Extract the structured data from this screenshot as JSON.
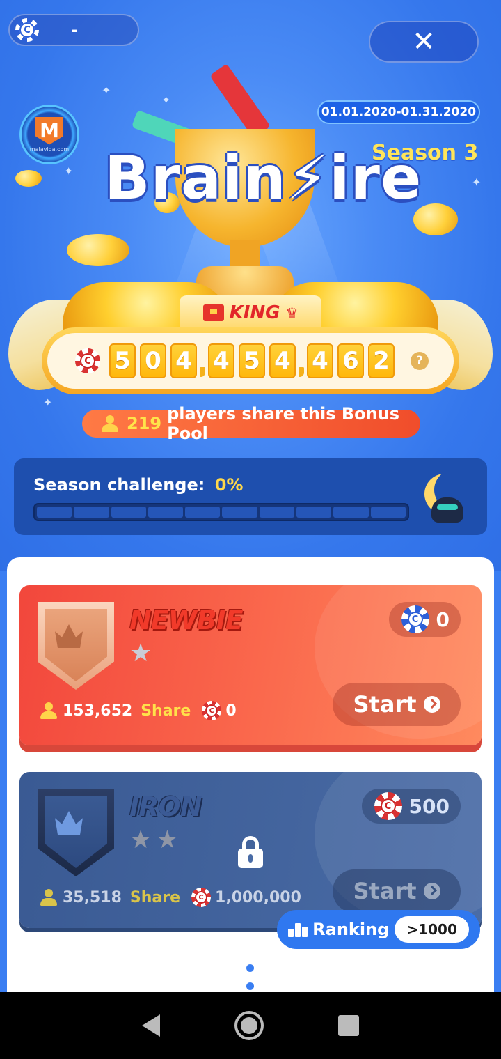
{
  "header": {
    "coin_balance": "-",
    "close_symbol": "✕",
    "date_range": "01.01.2020-01.31.2020",
    "season": "Season 3",
    "brand": "Brain⚡ire"
  },
  "prize_pool": {
    "tag": "KING",
    "digits": [
      "5",
      "0",
      "4",
      "4",
      "5",
      "4",
      "4",
      "6",
      "2"
    ],
    "help": "?",
    "players_count": "219",
    "players_text": "players share this Bonus Pool"
  },
  "challenge": {
    "label": "Season challenge:",
    "percent": "0%",
    "progress": 0,
    "segments": 10
  },
  "tiers": [
    {
      "name": "NEWBIE",
      "stars": 1,
      "entry_fee": "0",
      "players": "153,652",
      "share_label": "Share",
      "share_amount": "0",
      "start_label": "Start",
      "locked": false
    },
    {
      "name": "IRON",
      "stars": 2,
      "entry_fee": "500",
      "players": "35,518",
      "share_label": "Share",
      "share_amount": "1,000,000",
      "start_label": "Start",
      "locked": true
    }
  ],
  "ranking": {
    "label": "Ranking",
    "value": ">1000"
  },
  "icons": {
    "chip": "poker-chip-icon",
    "person": "person-icon",
    "lock": "lock-icon",
    "star": "star-icon"
  },
  "colors": {
    "background": "#3a7ef2",
    "accent_yellow": "#ffd84a",
    "newbie": "#f2473c",
    "iron": "#3a5a93"
  }
}
